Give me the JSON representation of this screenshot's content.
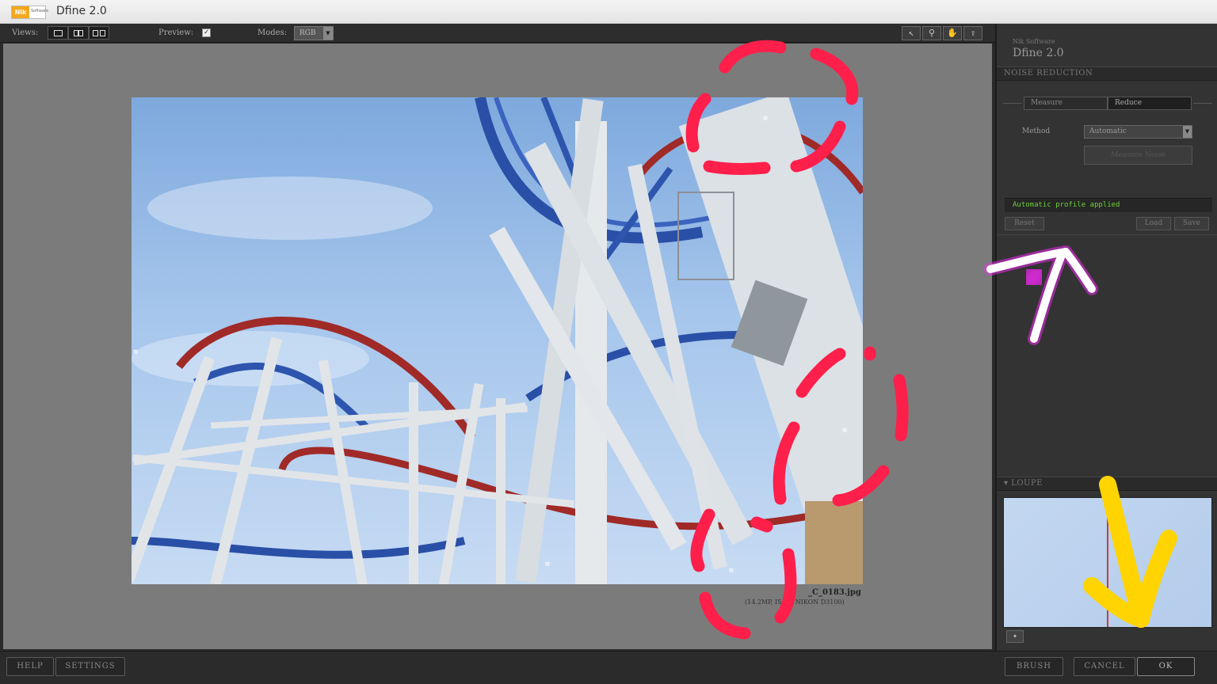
{
  "window": {
    "title": "Dfine 2.0",
    "logo_text": "Nik",
    "logo_subtext": "Software"
  },
  "toolbar": {
    "views_label": "Views:",
    "preview_label": "Preview:",
    "preview_checked": "✓",
    "modes_label": "Modes:",
    "modes_value": "RGB"
  },
  "image": {
    "filename": "_C_0183.jpg",
    "info": "(14.2MP, IS___, NIKON D3100)"
  },
  "panel": {
    "brand_small": "Nik Software",
    "brand_title": "Dfine 2.0",
    "section_noise": "NOISE REDUCTION",
    "tab_measure": "Measure",
    "tab_reduce": "Reduce",
    "method_label": "Method",
    "method_value": "Automatic",
    "measure_noise_button": "Measure Noise",
    "status_text": "Automatic profile applied",
    "reset_button": "Reset",
    "load_button": "Load",
    "save_button": "Save",
    "section_loupe": "LOUPE"
  },
  "footer": {
    "help_button": "HELP",
    "settings_button": "SETTINGS",
    "brush_button": "BRUSH",
    "cancel_button": "CANCEL",
    "ok_button": "OK"
  },
  "colors": {
    "status_green": "#6ed23a",
    "annotation_red": "#ff1f4b",
    "annotation_magenta": "#ff28ff",
    "annotation_yellow": "#ffd400"
  }
}
